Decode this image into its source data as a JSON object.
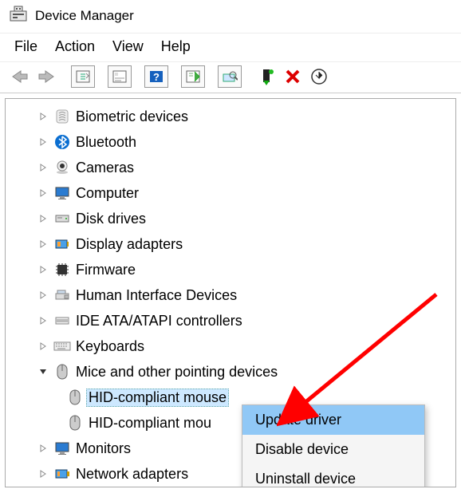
{
  "title": "Device Manager",
  "menu": {
    "file": "File",
    "action": "Action",
    "view": "View",
    "help": "Help"
  },
  "tree": {
    "items": [
      {
        "label": "Biometric devices",
        "expanded": false
      },
      {
        "label": "Bluetooth",
        "expanded": false
      },
      {
        "label": "Cameras",
        "expanded": false
      },
      {
        "label": "Computer",
        "expanded": false
      },
      {
        "label": "Disk drives",
        "expanded": false
      },
      {
        "label": "Display adapters",
        "expanded": false
      },
      {
        "label": "Firmware",
        "expanded": false
      },
      {
        "label": "Human Interface Devices",
        "expanded": false
      },
      {
        "label": "IDE ATA/ATAPI controllers",
        "expanded": false
      },
      {
        "label": "Keyboards",
        "expanded": false
      },
      {
        "label": "Mice and other pointing devices",
        "expanded": true,
        "children": [
          {
            "label": "HID-compliant mouse",
            "selected": true
          },
          {
            "label": "HID-compliant mou"
          }
        ]
      },
      {
        "label": "Monitors",
        "expanded": false
      },
      {
        "label": "Network adapters",
        "expanded": false
      }
    ]
  },
  "context_menu": {
    "items": [
      {
        "label": "Update driver",
        "hover": true
      },
      {
        "label": "Disable device",
        "hover": false
      },
      {
        "label": "Uninstall device",
        "hover": false
      }
    ]
  }
}
